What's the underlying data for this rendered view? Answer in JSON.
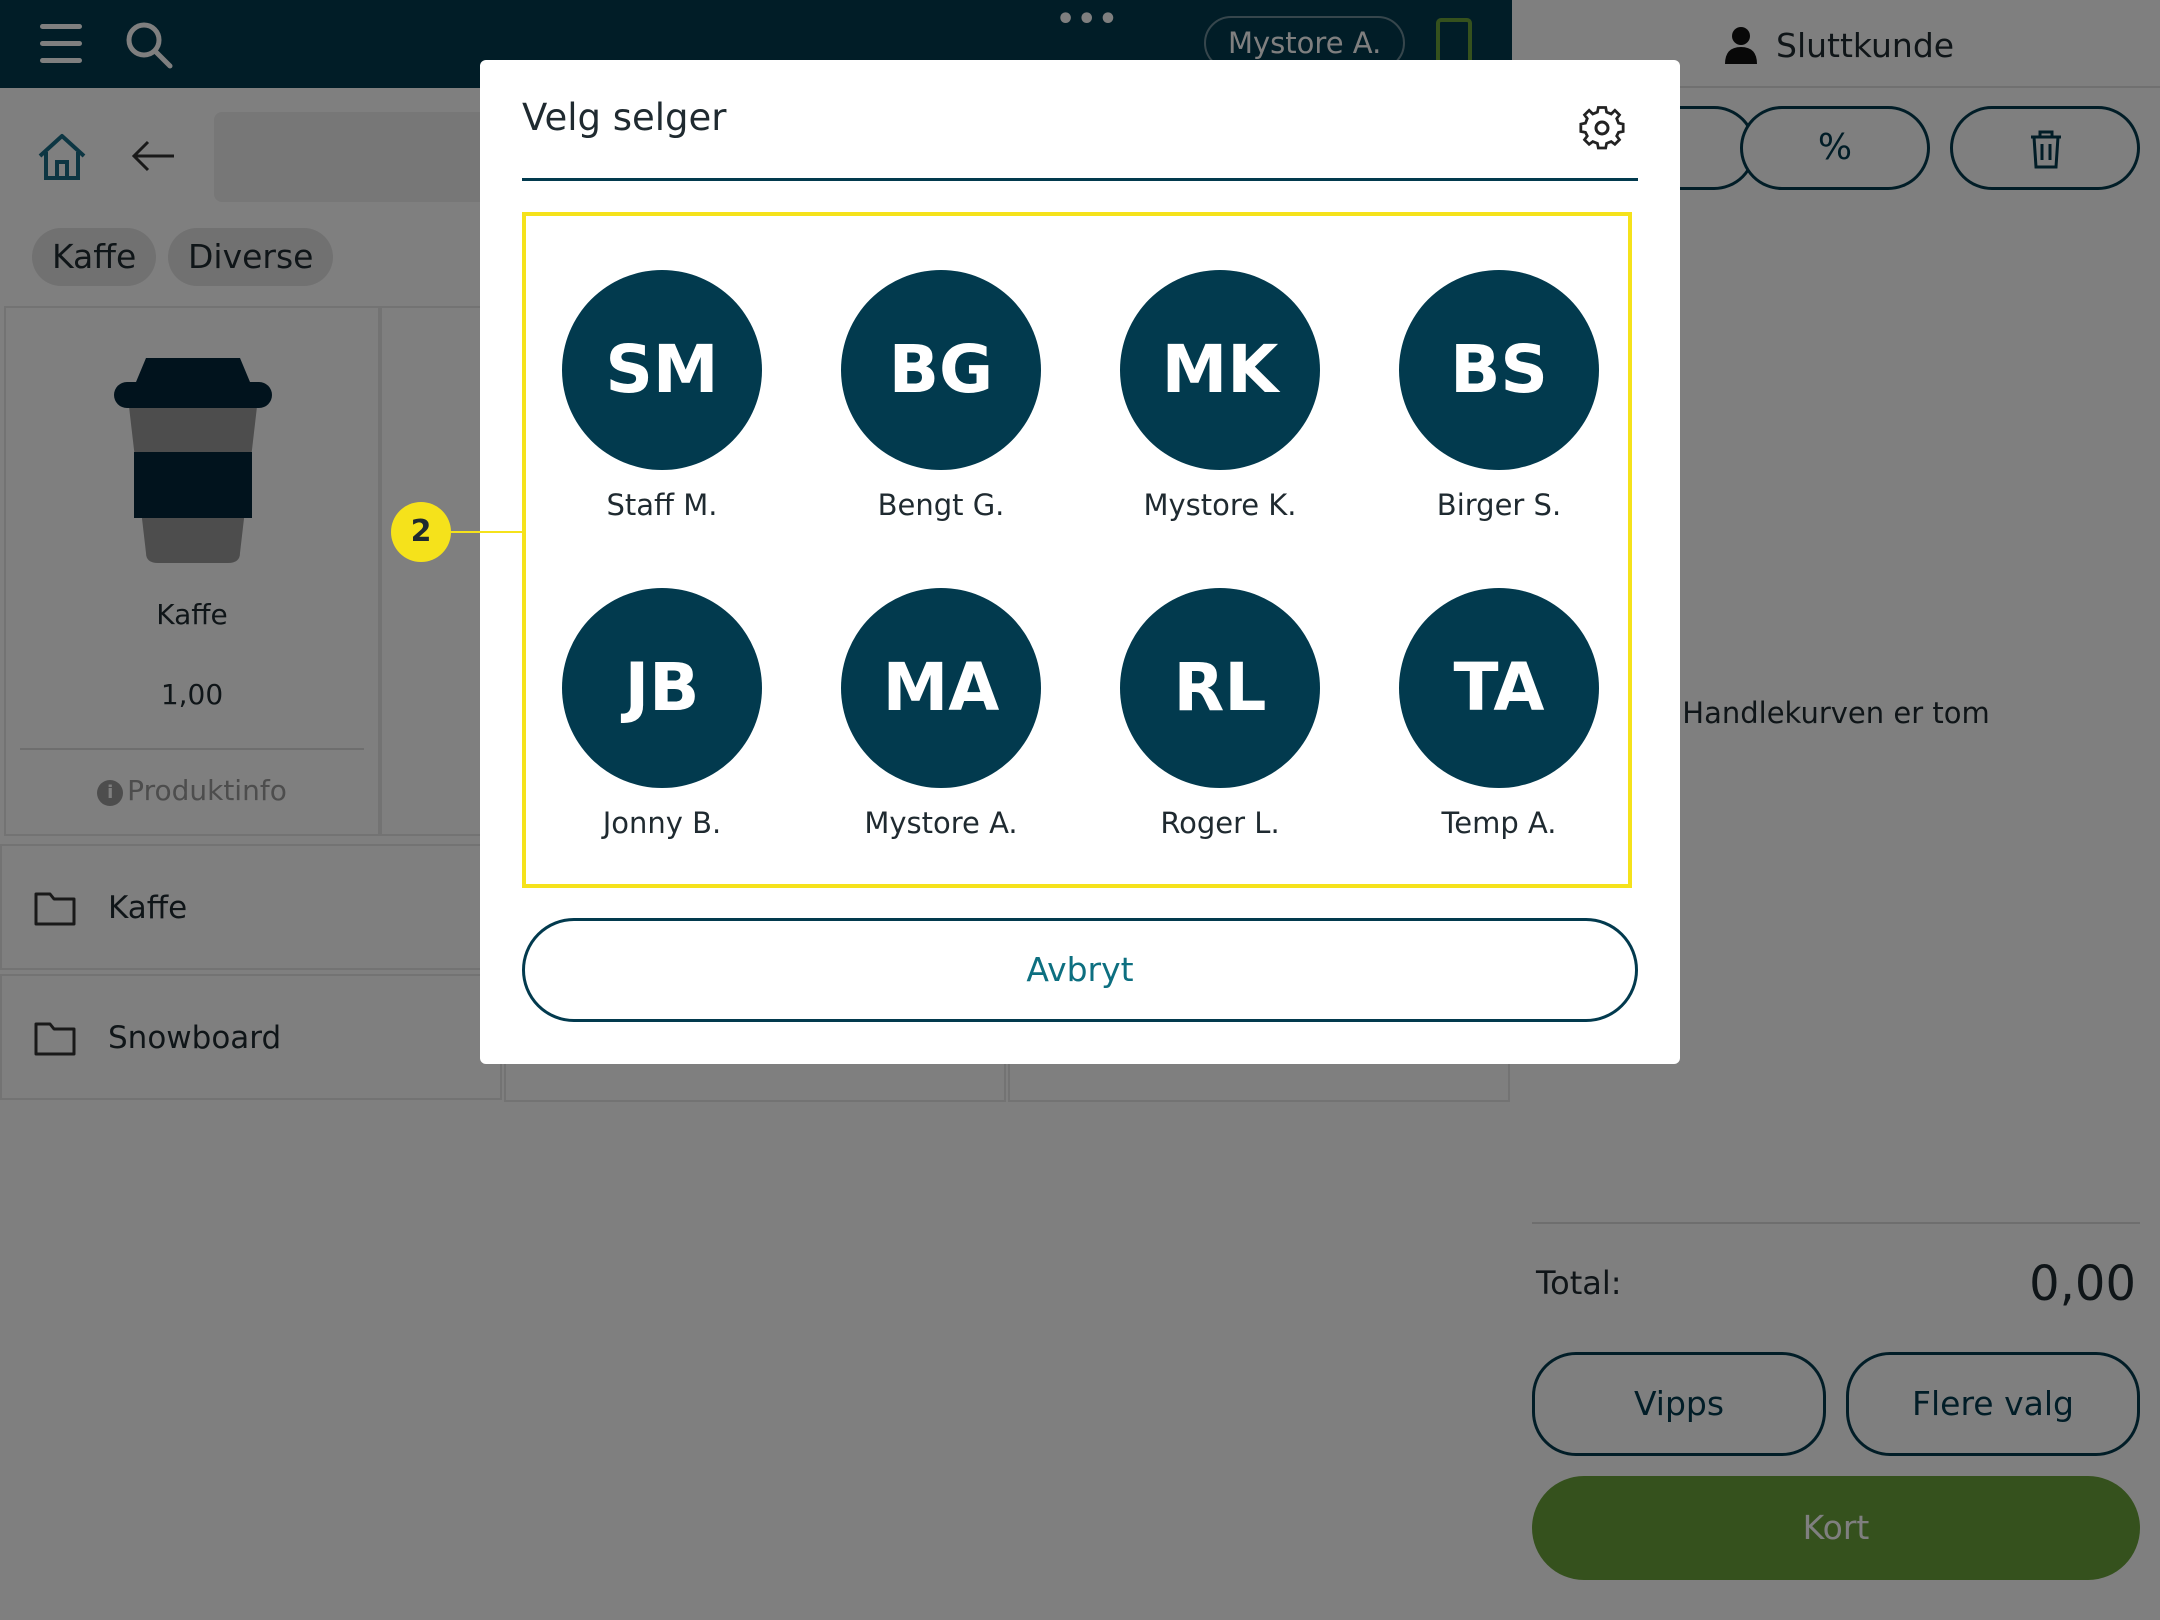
{
  "topbar": {
    "current_user": "Mystore A.",
    "more_glyph": "•••"
  },
  "categories": [
    "Kaffe",
    "Diverse"
  ],
  "product": {
    "name": "Kaffe",
    "price": "1,00",
    "info_label": "Produktinfo",
    "info_glyph": "i"
  },
  "folders": [
    "Kaffe",
    "Snowboard"
  ],
  "cart": {
    "customer": "Sluttkunde",
    "empty_text": "Handlekurven er tom",
    "discount_glyph": "%",
    "total_label": "Total:",
    "total_value": "0,00",
    "vipps_label": "Vipps",
    "more_label": "Flere valg",
    "card_label": "Kort"
  },
  "dialog": {
    "title": "Velg selger",
    "cancel_label": "Avbryt",
    "sellers": [
      {
        "initials": "SM",
        "name": "Staff M."
      },
      {
        "initials": "BG",
        "name": "Bengt G."
      },
      {
        "initials": "MK",
        "name": "Mystore K."
      },
      {
        "initials": "BS",
        "name": "Birger S."
      },
      {
        "initials": "JB",
        "name": "Jonny B."
      },
      {
        "initials": "MA",
        "name": "Mystore A."
      },
      {
        "initials": "RL",
        "name": "Roger L."
      },
      {
        "initials": "TA",
        "name": "Temp A."
      }
    ]
  },
  "callout": {
    "number": "2"
  },
  "colors": {
    "brand_dark": "#023a4e",
    "accent_green": "#6aa23a",
    "highlight_yellow": "#f5e21b",
    "link_teal": "#0d6f80"
  },
  "icons": [
    "menu-icon",
    "search-icon",
    "calculator-icon",
    "home-icon",
    "back-arrow-icon",
    "coffee-cup-icon",
    "info-icon",
    "folder-icon",
    "person-icon",
    "percent-icon",
    "trash-icon",
    "gear-icon"
  ]
}
